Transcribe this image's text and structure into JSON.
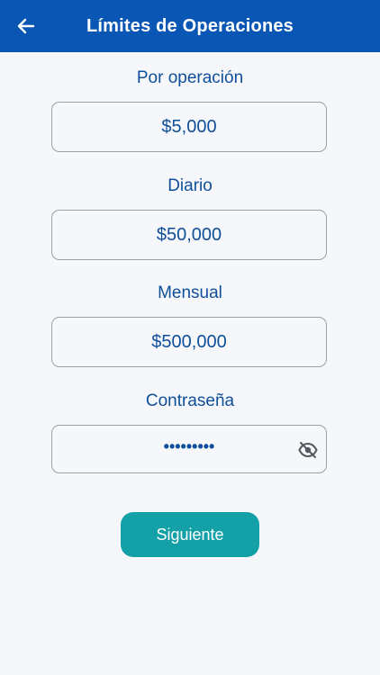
{
  "header": {
    "title": "Límites de Operaciones",
    "back_icon": "arrow-left-icon"
  },
  "limits": {
    "per_operation": {
      "label": "Por operación",
      "value": "$5,000"
    },
    "daily": {
      "label": "Diario",
      "value": "$50,000"
    },
    "monthly": {
      "label": "Mensual",
      "value": "$500,000"
    }
  },
  "password": {
    "label": "Contraseña",
    "value": "•••••••••",
    "toggle_icon": "eye-off-icon"
  },
  "actions": {
    "next_label": "Siguiente"
  },
  "colors": {
    "header_bg": "#0a56b4",
    "text_primary": "#0f4f9a",
    "button_bg": "#14a0a7",
    "page_bg": "#f6f7fb"
  }
}
